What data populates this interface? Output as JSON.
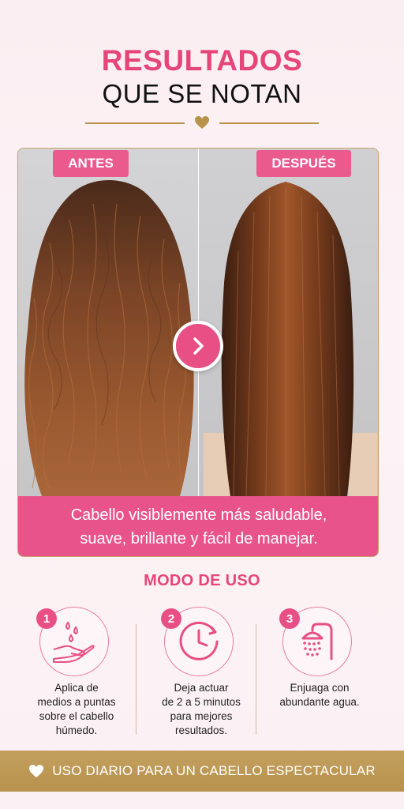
{
  "header": {
    "title_line1": "RESULTADOS",
    "title_line2": "QUE SE NOTAN"
  },
  "comparison": {
    "before_label": "ANTES",
    "after_label": "DESPUÉS",
    "caption_line1": "Cabello visiblemente más saludable,",
    "caption_line2": "suave, brillante y fácil de manejar."
  },
  "usage": {
    "title": "MODO DE USO",
    "steps": [
      {
        "number": "1",
        "icon": "hand-drops-icon",
        "lines": [
          "Aplica de",
          "medios a puntas",
          "sobre el cabello",
          "húmedo."
        ]
      },
      {
        "number": "2",
        "icon": "clock-icon",
        "lines": [
          "Deja actuar",
          "de 2 a 5 minutos",
          "para mejores",
          "resultados."
        ]
      },
      {
        "number": "3",
        "icon": "shower-icon",
        "lines": [
          "Enjuaga con",
          "abundante agua."
        ]
      }
    ]
  },
  "footer": {
    "text": "USO DIARIO PARA UN CABELLO ESPECTACULAR"
  },
  "colors": {
    "accent_pink": "#e84f84",
    "gold": "#b8944a",
    "background": "#fbeef2"
  }
}
